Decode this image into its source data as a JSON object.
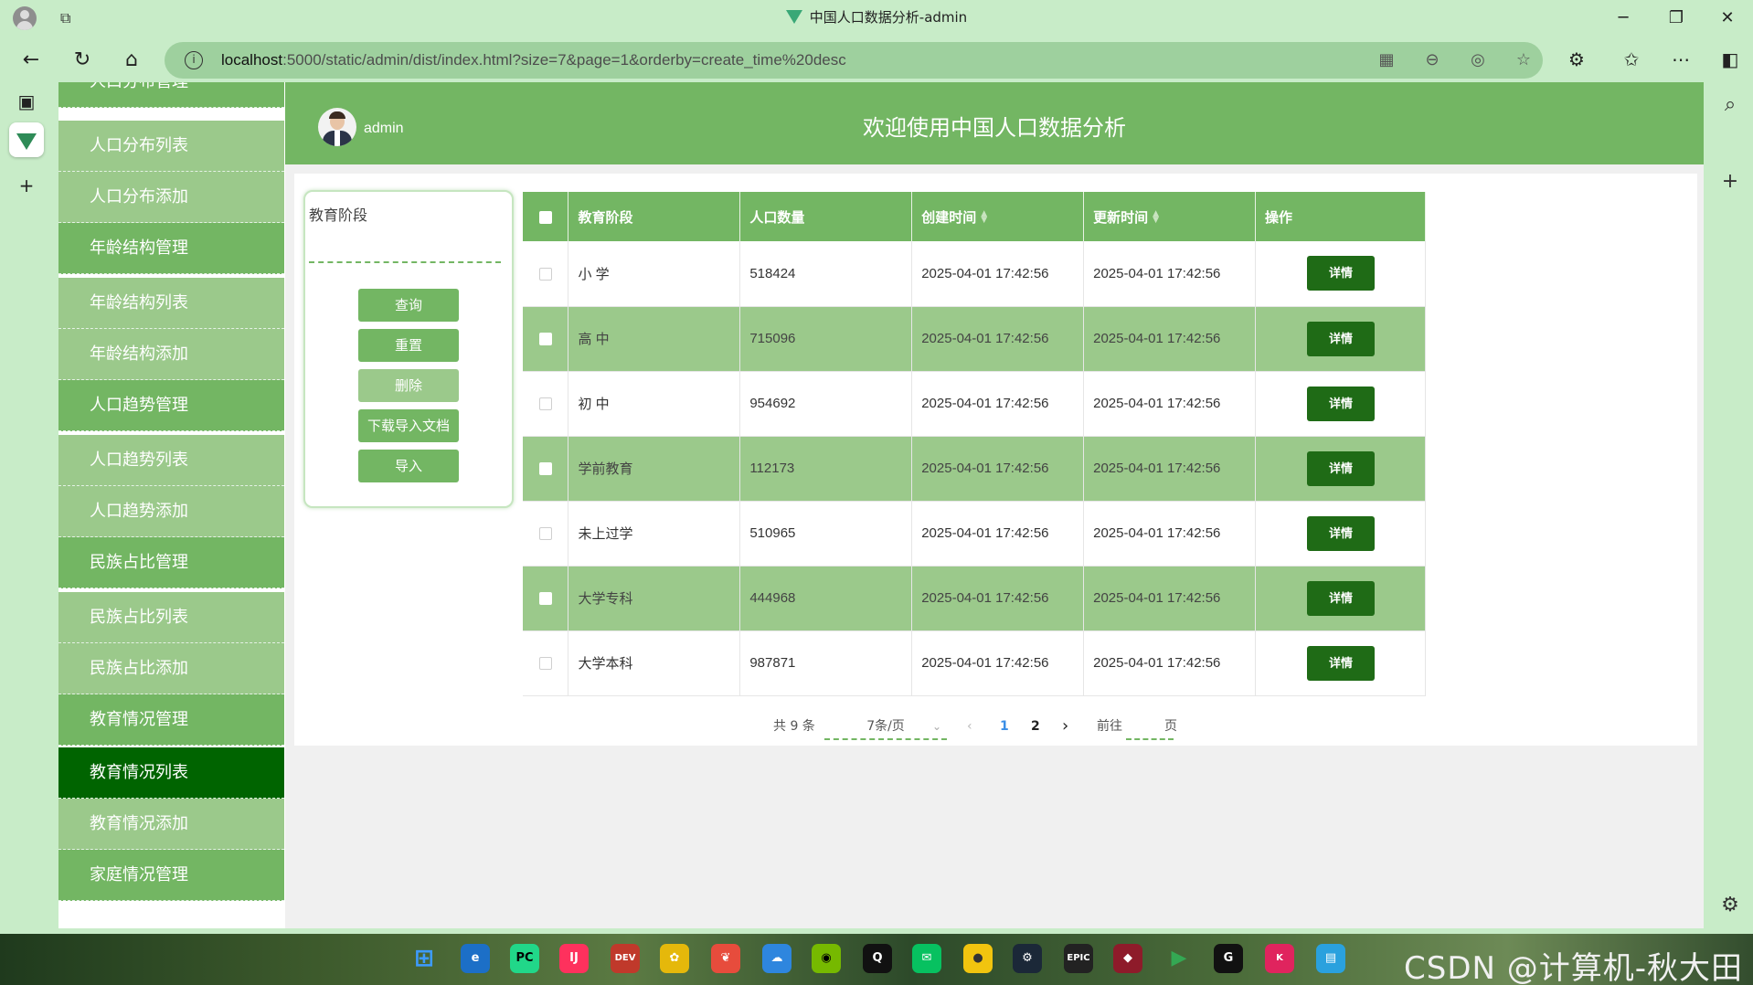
{
  "browser": {
    "tab_title": "中国人口数据分析-admin",
    "url_host": "localhost",
    "url_path": ":5000/static/admin/dist/index.html?size=7&page=1&orderby=create_time%20desc"
  },
  "header": {
    "username": "admin",
    "title": "欢迎使用中国人口数据分析"
  },
  "menu": {
    "items": [
      {
        "label": "人口分布管理",
        "kind": "group"
      },
      {
        "label": "人口分布列表",
        "kind": "sub"
      },
      {
        "label": "人口分布添加",
        "kind": "sub"
      },
      {
        "label": "年龄结构管理",
        "kind": "group"
      },
      {
        "label": "年龄结构列表",
        "kind": "sub"
      },
      {
        "label": "年龄结构添加",
        "kind": "sub"
      },
      {
        "label": "人口趋势管理",
        "kind": "group"
      },
      {
        "label": "人口趋势列表",
        "kind": "sub"
      },
      {
        "label": "人口趋势添加",
        "kind": "sub"
      },
      {
        "label": "民族占比管理",
        "kind": "group"
      },
      {
        "label": "民族占比列表",
        "kind": "sub"
      },
      {
        "label": "民族占比添加",
        "kind": "sub"
      },
      {
        "label": "教育情况管理",
        "kind": "group"
      },
      {
        "label": "教育情况列表",
        "kind": "active"
      },
      {
        "label": "教育情况添加",
        "kind": "sub"
      },
      {
        "label": "家庭情况管理",
        "kind": "group"
      }
    ]
  },
  "search": {
    "label": "教育阶段",
    "value": "",
    "buttons": {
      "query": "查询",
      "reset": "重置",
      "delete": "删除",
      "download": "下载导入文档",
      "import": "导入"
    }
  },
  "table": {
    "columns": [
      "教育阶段",
      "人口数量",
      "创建时间",
      "更新时间",
      "操作"
    ],
    "action_label": "详情",
    "rows": [
      {
        "stage": "小 学",
        "count": "518424",
        "created": "2025-04-01 17:42:56",
        "updated": "2025-04-01 17:42:56"
      },
      {
        "stage": "高 中",
        "count": "715096",
        "created": "2025-04-01 17:42:56",
        "updated": "2025-04-01 17:42:56"
      },
      {
        "stage": "初 中",
        "count": "954692",
        "created": "2025-04-01 17:42:56",
        "updated": "2025-04-01 17:42:56"
      },
      {
        "stage": "学前教育",
        "count": "112173",
        "created": "2025-04-01 17:42:56",
        "updated": "2025-04-01 17:42:56"
      },
      {
        "stage": "未上过学",
        "count": "510965",
        "created": "2025-04-01 17:42:56",
        "updated": "2025-04-01 17:42:56"
      },
      {
        "stage": "大学专科",
        "count": "444968",
        "created": "2025-04-01 17:42:56",
        "updated": "2025-04-01 17:42:56"
      },
      {
        "stage": "大学本科",
        "count": "987871",
        "created": "2025-04-01 17:42:56",
        "updated": "2025-04-01 17:42:56"
      }
    ]
  },
  "pagination": {
    "total": "共 9 条",
    "page_size": "7条/页",
    "pages": [
      "1",
      "2"
    ],
    "current_page": "1",
    "goto_prefix": "前往",
    "goto_suffix": "页"
  },
  "taskbar": {
    "watermark": "CSDN @计算机-秋大田"
  },
  "colors": {
    "primary": "#73b663",
    "submenu": "#9bc98b",
    "active": "#006400",
    "action_button": "#1f6b16",
    "chrome": "#c8ecc8"
  }
}
